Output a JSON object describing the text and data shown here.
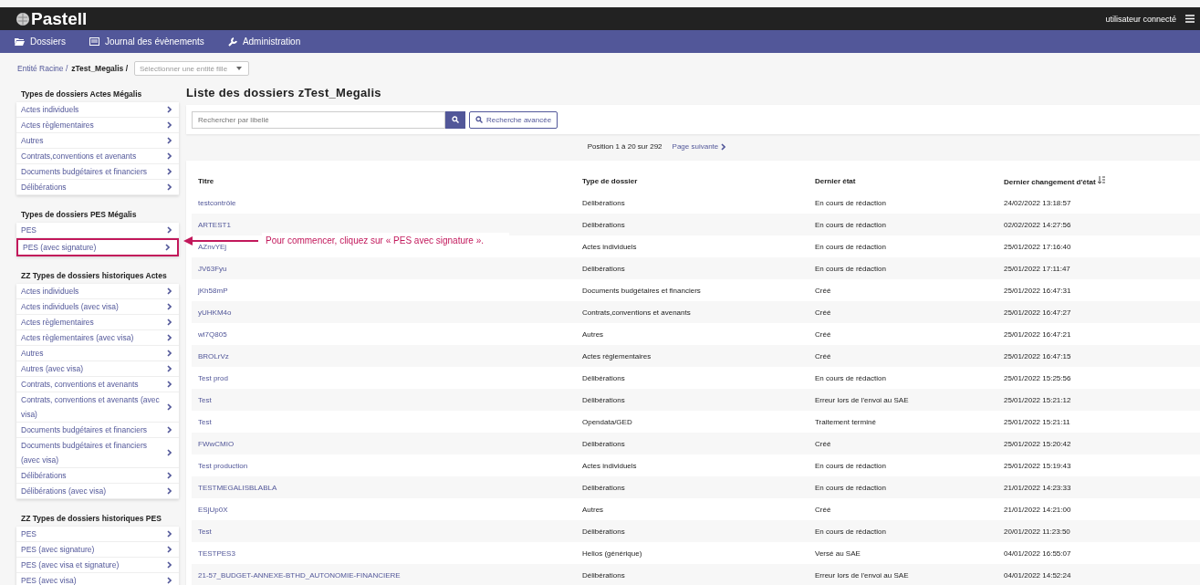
{
  "app": {
    "logo": "Pastell",
    "user": "utilisateur connecté"
  },
  "nav": [
    {
      "label": "Dossiers",
      "kind": "folder"
    },
    {
      "label": "Journal des évènements",
      "kind": "journal"
    },
    {
      "label": "Administration",
      "kind": "wrench"
    }
  ],
  "breadcrumb": {
    "root": "Entité Racine /",
    "current": "zTest_Megalis /",
    "select_placeholder": "Sélectionner une entité fille"
  },
  "sidebar": [
    {
      "title": "Types de dossiers Actes Mégalis",
      "items": [
        {
          "label": "Actes individuels",
          "highlighted": false
        },
        {
          "label": "Actes règlementaires",
          "highlighted": false
        },
        {
          "label": "Autres",
          "highlighted": false
        },
        {
          "label": "Contrats,conventions et avenants",
          "highlighted": false
        },
        {
          "label": "Documents budgétaires et financiers",
          "highlighted": false
        },
        {
          "label": "Délibérations",
          "highlighted": false
        }
      ]
    },
    {
      "title": "Types de dossiers PES Mégalis",
      "items": [
        {
          "label": "PES",
          "highlighted": false
        },
        {
          "label": "PES (avec signature)",
          "highlighted": true
        }
      ]
    },
    {
      "title": "ZZ Types de dossiers historiques Actes",
      "items": [
        {
          "label": "Actes individuels",
          "highlighted": false
        },
        {
          "label": "Actes individuels (avec visa)",
          "highlighted": false
        },
        {
          "label": "Actes règlementaires",
          "highlighted": false
        },
        {
          "label": "Actes règlementaires (avec visa)",
          "highlighted": false
        },
        {
          "label": "Autres",
          "highlighted": false
        },
        {
          "label": "Autres (avec visa)",
          "highlighted": false
        },
        {
          "label": "Contrats, conventions et avenants",
          "highlighted": false
        },
        {
          "label": "Contrats, conventions et avenants (avec visa)",
          "highlighted": false
        },
        {
          "label": "Documents budgétaires et financiers",
          "highlighted": false
        },
        {
          "label": "Documents budgétaires et financiers (avec visa)",
          "highlighted": false
        },
        {
          "label": "Délibérations",
          "highlighted": false
        },
        {
          "label": "Délibérations (avec visa)",
          "highlighted": false
        }
      ]
    },
    {
      "title": "ZZ Types de dossiers historiques PES",
      "items": [
        {
          "label": "PES",
          "highlighted": false
        },
        {
          "label": "PES (avec signature)",
          "highlighted": false
        },
        {
          "label": "PES (avec visa et signature)",
          "highlighted": false
        },
        {
          "label": "PES (avec visa)",
          "highlighted": false
        }
      ]
    }
  ],
  "annotation": {
    "text": "Pour commencer, cliquez sur « PES avec signature »."
  },
  "main": {
    "title": "Liste des dossiers zTest_Megalis",
    "search_placeholder": "Rechercher par libellé",
    "advanced_search": "Recherche avancée",
    "position": "Position 1 à 20 sur 292",
    "next_page": "Page suivante"
  },
  "table": {
    "columns": [
      "Titre",
      "Type de dossier",
      "Dernier état",
      "Dernier changement d'état"
    ],
    "rows": [
      [
        "testcontrôle",
        "Délibérations",
        "En cours de rédaction",
        "24/02/2022 13:18:57"
      ],
      [
        "ARTEST1",
        "Délibérations",
        "En cours de rédaction",
        "02/02/2022 14:27:56"
      ],
      [
        "AZnvYEj",
        "Actes individuels",
        "En cours de rédaction",
        "25/01/2022 17:16:40"
      ],
      [
        "JV63Fyu",
        "Délibérations",
        "En cours de rédaction",
        "25/01/2022 17:11:47"
      ],
      [
        "jKh58mP",
        "Documents budgétaires et financiers",
        "Créé",
        "25/01/2022 16:47:31"
      ],
      [
        "yUHKM4o",
        "Contrats,conventions et avenants",
        "Créé",
        "25/01/2022 16:47:27"
      ],
      [
        "wl7Q805",
        "Autres",
        "Créé",
        "25/01/2022 16:47:21"
      ],
      [
        "BROLrVz",
        "Actes règlementaires",
        "Créé",
        "25/01/2022 16:47:15"
      ],
      [
        "Test prod",
        "Délibérations",
        "En cours de rédaction",
        "25/01/2022 15:25:56"
      ],
      [
        "Test",
        "Délibérations",
        "Erreur lors de l'envoi au SAE",
        "25/01/2022 15:21:12"
      ],
      [
        "Test",
        "Opendata/GED",
        "Traitement terminé",
        "25/01/2022 15:21:11"
      ],
      [
        "FWwCMIO",
        "Délibérations",
        "Créé",
        "25/01/2022 15:20:42"
      ],
      [
        "Test production",
        "Actes individuels",
        "En cours de rédaction",
        "25/01/2022 15:19:43"
      ],
      [
        "TESTMEGALISBLABLA",
        "Délibérations",
        "En cours de rédaction",
        "21/01/2022 14:23:33"
      ],
      [
        "ESjUp0X",
        "Autres",
        "Créé",
        "21/01/2022 14:21:00"
      ],
      [
        "Test",
        "Délibérations",
        "En cours de rédaction",
        "20/01/2022 11:23:50"
      ],
      [
        "TESTPES3",
        "Helios (générique)",
        "Versé au SAE",
        "04/01/2022 16:55:07"
      ],
      [
        "21-57_BUDGET-ANNEXE-BTHD_AUTONOMIE-FINANCIERE",
        "Délibérations",
        "Erreur lors de l'envoi au SAE",
        "04/01/2022 14:52:24"
      ]
    ]
  }
}
